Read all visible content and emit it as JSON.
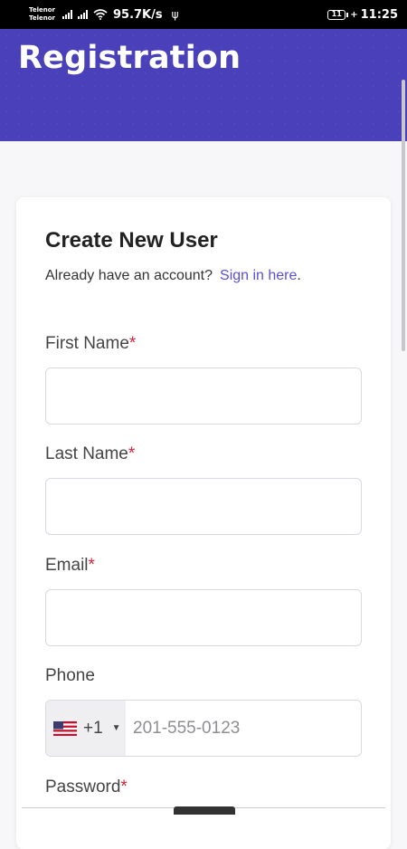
{
  "status_bar": {
    "carrier1": "Telenor",
    "carrier2": "Telenor",
    "net_speed": "95.7K/s",
    "battery": "11",
    "time": "11:25"
  },
  "header": {
    "title": "Registration"
  },
  "form": {
    "title": "Create New User",
    "signin_prompt": "Already have an account?",
    "signin_link": "Sign in here",
    "signin_period": ".",
    "first_name_label": "First Name",
    "last_name_label": "Last Name",
    "email_label": "Email",
    "phone_label": "Phone",
    "password_label": "Password",
    "required_marker": "*",
    "phone_country_code": "+1",
    "phone_placeholder": "201-555-0123"
  },
  "colors": {
    "header_bg": "#4a40b9",
    "link": "#5a50d6",
    "required": "#d0243c"
  },
  "icons": [
    "signal-icon",
    "wifi-icon",
    "usb-icon",
    "battery-icon",
    "us-flag-icon",
    "dropdown-caret-icon"
  ]
}
